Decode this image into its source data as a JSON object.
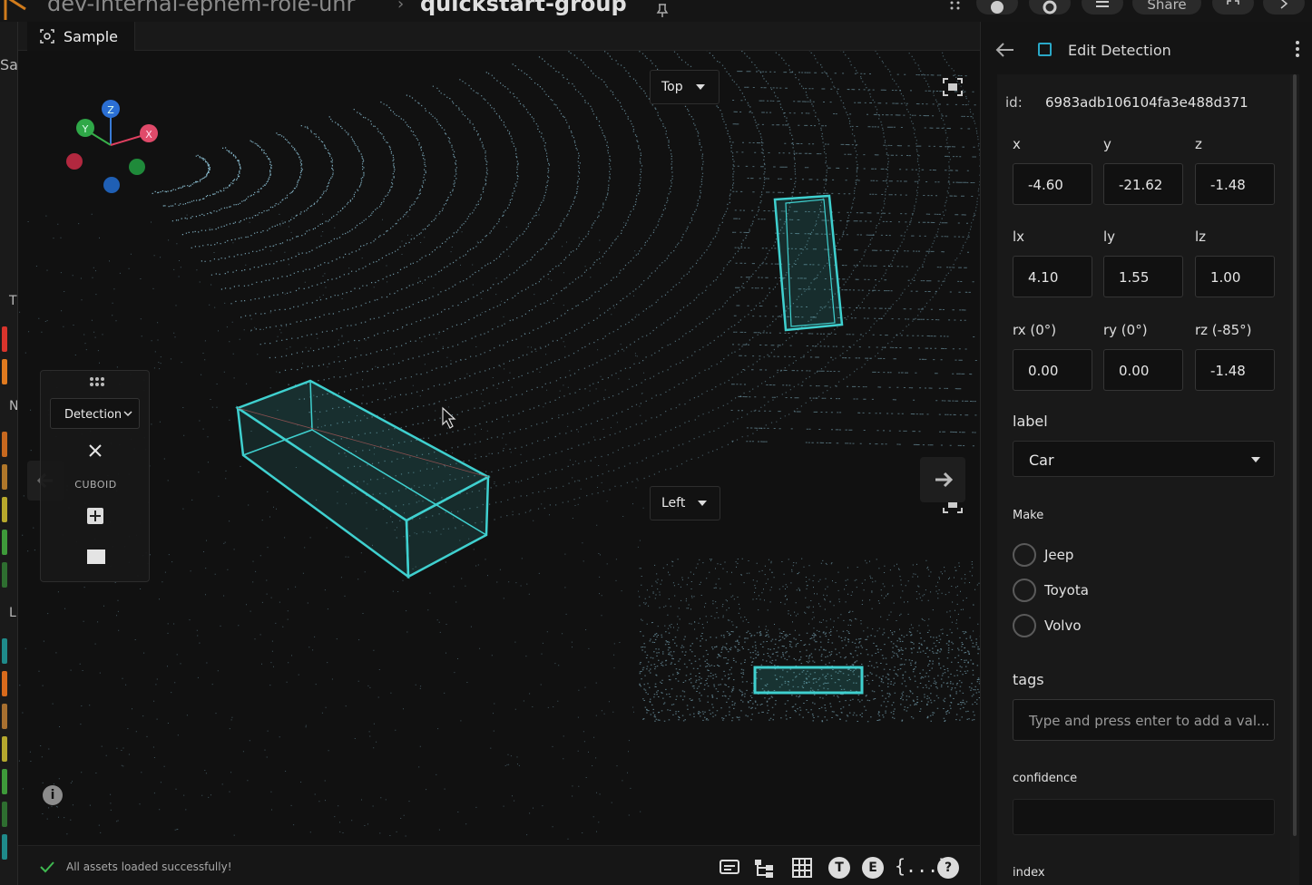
{
  "breadcrumb": {
    "dataset": "dev-internal-ephem-role-unr",
    "group": "quickstart-group"
  },
  "topbar": {
    "share_label": "Share"
  },
  "gutter": {
    "stubs": [
      "Sa",
      "T",
      "N",
      "L"
    ]
  },
  "tab": {
    "label": "Sample"
  },
  "viewports": {
    "top_view": "Top",
    "left_view": "Left"
  },
  "axes": {
    "x": "X",
    "y": "Y",
    "z": "Z"
  },
  "toolbar": {
    "mode": "Detection",
    "shape_label": "CUBOID"
  },
  "status": {
    "message": "All assets loaded successfully!",
    "t_icon": "T",
    "e_icon": "E",
    "json_icon": "{...}",
    "help_icon": "?",
    "info_icon": "i"
  },
  "panel": {
    "title": "Edit Detection",
    "id_label": "id:",
    "id_value": "6983adb106104fa3e488d371",
    "position": {
      "x_label": "x",
      "y_label": "y",
      "z_label": "z",
      "x": "-4.60",
      "y": "-21.62",
      "z": "-1.48"
    },
    "dimensions": {
      "lx_label": "lx",
      "ly_label": "ly",
      "lz_label": "lz",
      "lx": "4.10",
      "ly": "1.55",
      "lz": "1.00"
    },
    "rotation": {
      "rx_label": "rx (0°)",
      "ry_label": "ry (0°)",
      "rz_label": "rz (-85°)",
      "rx": "0.00",
      "ry": "0.00",
      "rz": "-1.48"
    },
    "label_title": "label",
    "label_value": "Car",
    "make_title": "Make",
    "make_options": [
      "Jeep",
      "Toyota",
      "Volvo"
    ],
    "tags_title": "tags",
    "tags_placeholder": "Type and press enter to add a val...",
    "confidence_title": "confidence",
    "index_title": "index"
  },
  "colors": {
    "accent": "#2aa8c7",
    "cuboid": "#3fd0cf",
    "points": "#9ad4ea"
  }
}
